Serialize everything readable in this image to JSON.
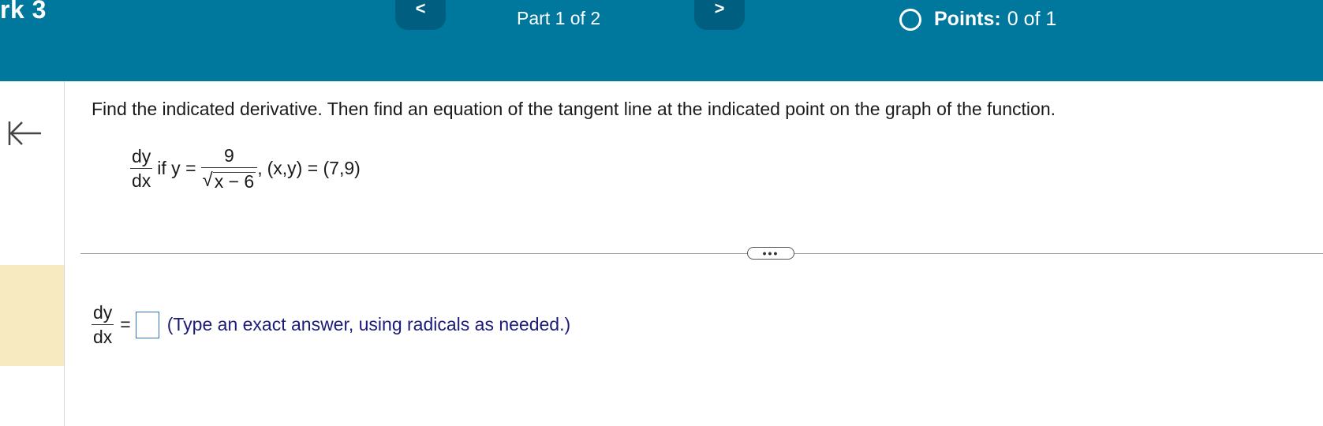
{
  "header": {
    "assignment_title": "rk 3",
    "part_label": "Part 1 of 2",
    "prev_symbol": "<",
    "next_symbol": ">",
    "points_label": "Points:",
    "points_value": "0 of 1"
  },
  "question": {
    "instruction": "Find the indicated derivative. Then find an equation of the tangent line at the indicated point on the graph of the function.",
    "derivative_num": "dy",
    "derivative_den": "dx",
    "if_text": "if y =",
    "func_num": "9",
    "func_den": "x − 6",
    "comma": ",",
    "point_text": "(x,y) = (7,9)"
  },
  "divider": {
    "more_symbol": "•••"
  },
  "answer": {
    "lhs_num": "dy",
    "lhs_den": "dx",
    "equals": "=",
    "hint": "(Type an exact answer, using radicals as needed.)"
  },
  "colors": {
    "header_bg": "#00789e",
    "nav_button_bg": "#005f80",
    "sidebar_highlight": "#f8eac0",
    "hint_text": "#1b1b7a",
    "answer_box_border": "#2f6fbf"
  }
}
